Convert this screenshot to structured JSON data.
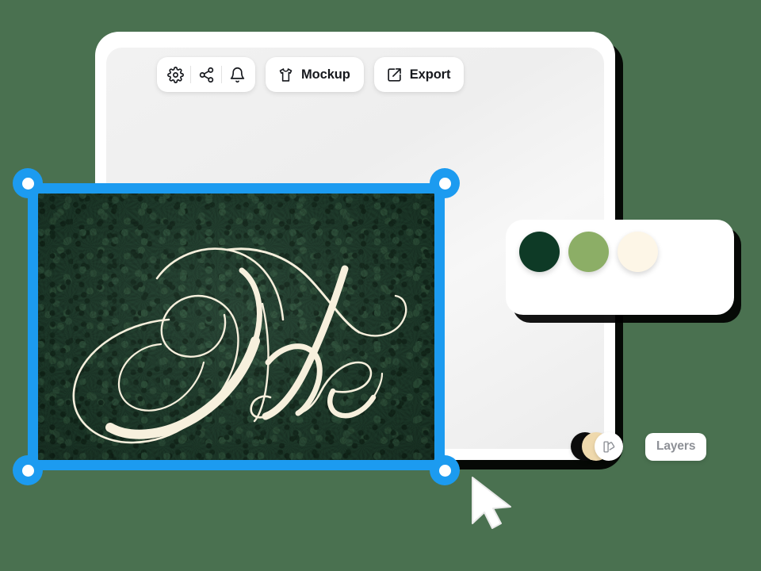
{
  "background": {
    "color": "#4a7150"
  },
  "window": {
    "name": "design-editor-window",
    "surface_color": "#ffffff",
    "canvas_color": "#f1f1f1"
  },
  "toolbar": {
    "icon_group": [
      {
        "name": "settings-icon",
        "label": "Settings"
      },
      {
        "name": "share-icon",
        "label": "Share"
      },
      {
        "name": "bell-icon",
        "label": "Notifications"
      }
    ],
    "mockup_button": {
      "label": "Mockup",
      "icon": "tshirt-icon"
    },
    "export_button": {
      "label": "Export",
      "icon": "external-link-icon"
    }
  },
  "color_panel": {
    "name": "color-palette-panel",
    "swatches": [
      {
        "name": "swatch-dark-green",
        "color": "#0e3a26"
      },
      {
        "name": "swatch-sage-green",
        "color": "#8cae66"
      },
      {
        "name": "swatch-cream",
        "color": "#fdf6e7"
      }
    ]
  },
  "bottom_bar": {
    "avatars": [
      {
        "name": "avatar-black",
        "color": "#0c0c0c"
      },
      {
        "name": "avatar-tan",
        "color": "#efd9ad"
      },
      {
        "name": "avatar-palette",
        "color": "#ffffff",
        "icon": "palette-swatch-icon"
      }
    ],
    "layers_button": {
      "label": "Layers"
    }
  },
  "artboard": {
    "name": "selected-artboard",
    "artwork_text": "The",
    "background_color": "#1d3b2a",
    "script_color": "#f7f0dd",
    "selection": {
      "color": "#1c9bf0",
      "handles": [
        "top-left",
        "top-right",
        "bottom-left",
        "bottom-right"
      ]
    }
  },
  "cursor": {
    "name": "mouse-cursor",
    "color": "#ffffff"
  }
}
